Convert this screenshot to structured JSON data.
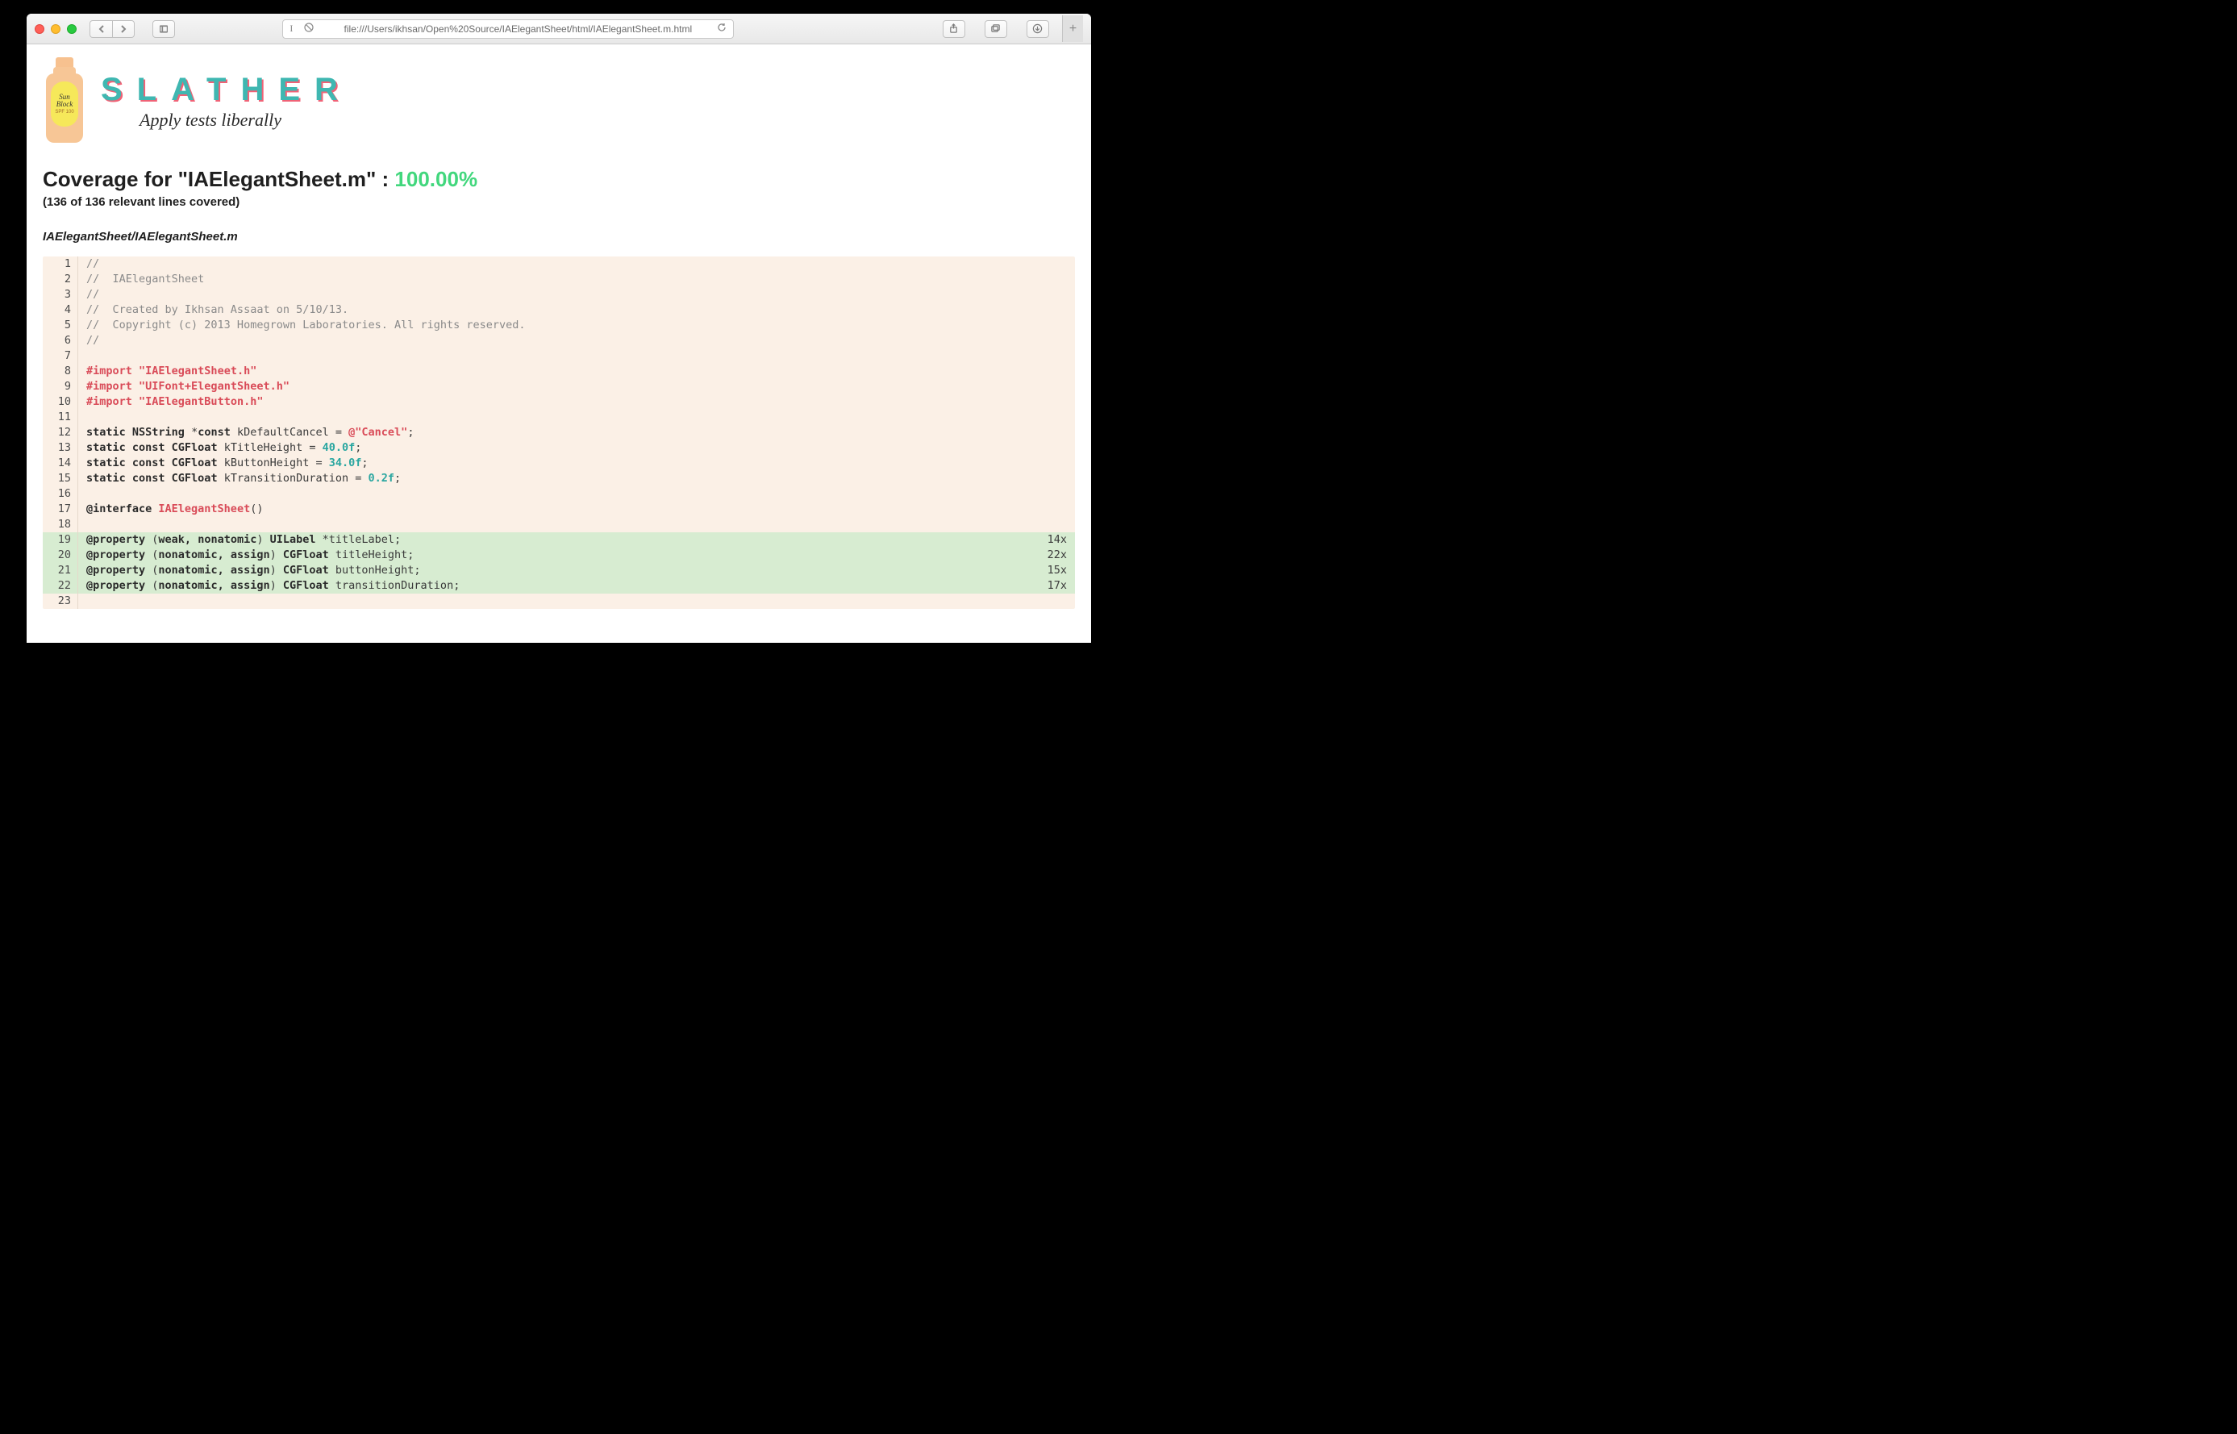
{
  "browser": {
    "url": "file:///Users/ikhsan/Open%20Source/IAElegantSheet/html/IAElegantSheet.m.html",
    "reader_glyph": "I"
  },
  "logo": {
    "brand": "SLATHER",
    "tagline": "Apply tests liberally",
    "bottle_label_1": "Sun",
    "bottle_label_2": "Block",
    "bottle_spf": "SPF 100"
  },
  "coverage": {
    "title_prefix": "Coverage for \"IAElegantSheet.m\" : ",
    "pct": "100.00%",
    "subtitle": "(136 of 136 relevant lines covered)",
    "filepath": "IAElegantSheet/IAElegantSheet.m"
  },
  "code": {
    "lines": [
      {
        "n": 1,
        "covered": false,
        "hits": "",
        "tokens": [
          {
            "c": "c-comment",
            "t": "//"
          }
        ]
      },
      {
        "n": 2,
        "covered": false,
        "hits": "",
        "tokens": [
          {
            "c": "c-comment",
            "t": "//  IAElegantSheet"
          }
        ]
      },
      {
        "n": 3,
        "covered": false,
        "hits": "",
        "tokens": [
          {
            "c": "c-comment",
            "t": "//"
          }
        ]
      },
      {
        "n": 4,
        "covered": false,
        "hits": "",
        "tokens": [
          {
            "c": "c-comment",
            "t": "//  Created by Ikhsan Assaat on 5/10/13."
          }
        ]
      },
      {
        "n": 5,
        "covered": false,
        "hits": "",
        "tokens": [
          {
            "c": "c-comment",
            "t": "//  Copyright (c) 2013 Homegrown Laboratories. All rights reserved."
          }
        ]
      },
      {
        "n": 6,
        "covered": false,
        "hits": "",
        "tokens": [
          {
            "c": "c-comment",
            "t": "//"
          }
        ]
      },
      {
        "n": 7,
        "covered": false,
        "hits": "",
        "tokens": [
          {
            "c": "",
            "t": ""
          }
        ]
      },
      {
        "n": 8,
        "covered": false,
        "hits": "",
        "tokens": [
          {
            "c": "c-pre",
            "t": "#import "
          },
          {
            "c": "c-str",
            "t": "\"IAElegantSheet.h\""
          }
        ]
      },
      {
        "n": 9,
        "covered": false,
        "hits": "",
        "tokens": [
          {
            "c": "c-pre",
            "t": "#import "
          },
          {
            "c": "c-str",
            "t": "\"UIFont+ElegantSheet.h\""
          }
        ]
      },
      {
        "n": 10,
        "covered": false,
        "hits": "",
        "tokens": [
          {
            "c": "c-pre",
            "t": "#import "
          },
          {
            "c": "c-str",
            "t": "\"IAElegantButton.h\""
          }
        ]
      },
      {
        "n": 11,
        "covered": false,
        "hits": "",
        "tokens": [
          {
            "c": "",
            "t": ""
          }
        ]
      },
      {
        "n": 12,
        "covered": false,
        "hits": "",
        "tokens": [
          {
            "c": "c-kw",
            "t": "static "
          },
          {
            "c": "c-type",
            "t": "NSString "
          },
          {
            "c": "",
            "t": "*"
          },
          {
            "c": "c-kw",
            "t": "const"
          },
          {
            "c": "",
            "t": " kDefaultCancel = "
          },
          {
            "c": "c-str",
            "t": "@\"Cancel\""
          },
          {
            "c": "",
            "t": ";"
          }
        ]
      },
      {
        "n": 13,
        "covered": false,
        "hits": "",
        "tokens": [
          {
            "c": "c-kw",
            "t": "static const "
          },
          {
            "c": "c-type",
            "t": "CGFloat"
          },
          {
            "c": "",
            "t": " kTitleHeight = "
          },
          {
            "c": "c-num",
            "t": "40.0f"
          },
          {
            "c": "",
            "t": ";"
          }
        ]
      },
      {
        "n": 14,
        "covered": false,
        "hits": "",
        "tokens": [
          {
            "c": "c-kw",
            "t": "static const "
          },
          {
            "c": "c-type",
            "t": "CGFloat"
          },
          {
            "c": "",
            "t": " kButtonHeight = "
          },
          {
            "c": "c-num",
            "t": "34.0f"
          },
          {
            "c": "",
            "t": ";"
          }
        ]
      },
      {
        "n": 15,
        "covered": false,
        "hits": "",
        "tokens": [
          {
            "c": "c-kw",
            "t": "static const "
          },
          {
            "c": "c-type",
            "t": "CGFloat"
          },
          {
            "c": "",
            "t": " kTransitionDuration = "
          },
          {
            "c": "c-num",
            "t": "0.2f"
          },
          {
            "c": "",
            "t": ";"
          }
        ]
      },
      {
        "n": 16,
        "covered": false,
        "hits": "",
        "tokens": [
          {
            "c": "",
            "t": ""
          }
        ]
      },
      {
        "n": 17,
        "covered": false,
        "hits": "",
        "tokens": [
          {
            "c": "c-at",
            "t": "@interface "
          },
          {
            "c": "c-cls",
            "t": "IAElegantSheet"
          },
          {
            "c": "",
            "t": "()"
          }
        ]
      },
      {
        "n": 18,
        "covered": false,
        "hits": "",
        "tokens": [
          {
            "c": "",
            "t": ""
          }
        ]
      },
      {
        "n": 19,
        "covered": true,
        "hits": "14x",
        "tokens": [
          {
            "c": "c-at",
            "t": "@property"
          },
          {
            "c": "",
            "t": " ("
          },
          {
            "c": "c-kw",
            "t": "weak, nonatomic"
          },
          {
            "c": "",
            "t": ") "
          },
          {
            "c": "c-type",
            "t": "UILabel"
          },
          {
            "c": "",
            "t": " *titleLabel;"
          }
        ]
      },
      {
        "n": 20,
        "covered": true,
        "hits": "22x",
        "tokens": [
          {
            "c": "c-at",
            "t": "@property"
          },
          {
            "c": "",
            "t": " ("
          },
          {
            "c": "c-kw",
            "t": "nonatomic, assign"
          },
          {
            "c": "",
            "t": ") "
          },
          {
            "c": "c-type",
            "t": "CGFloat"
          },
          {
            "c": "",
            "t": " titleHeight;"
          }
        ]
      },
      {
        "n": 21,
        "covered": true,
        "hits": "15x",
        "tokens": [
          {
            "c": "c-at",
            "t": "@property"
          },
          {
            "c": "",
            "t": " ("
          },
          {
            "c": "c-kw",
            "t": "nonatomic, assign"
          },
          {
            "c": "",
            "t": ") "
          },
          {
            "c": "c-type",
            "t": "CGFloat"
          },
          {
            "c": "",
            "t": " buttonHeight;"
          }
        ]
      },
      {
        "n": 22,
        "covered": true,
        "hits": "17x",
        "tokens": [
          {
            "c": "c-at",
            "t": "@property"
          },
          {
            "c": "",
            "t": " ("
          },
          {
            "c": "c-kw",
            "t": "nonatomic, assign"
          },
          {
            "c": "",
            "t": ") "
          },
          {
            "c": "c-type",
            "t": "CGFloat"
          },
          {
            "c": "",
            "t": " transitionDuration;"
          }
        ]
      },
      {
        "n": 23,
        "covered": false,
        "hits": "",
        "tokens": [
          {
            "c": "",
            "t": ""
          }
        ]
      }
    ]
  }
}
